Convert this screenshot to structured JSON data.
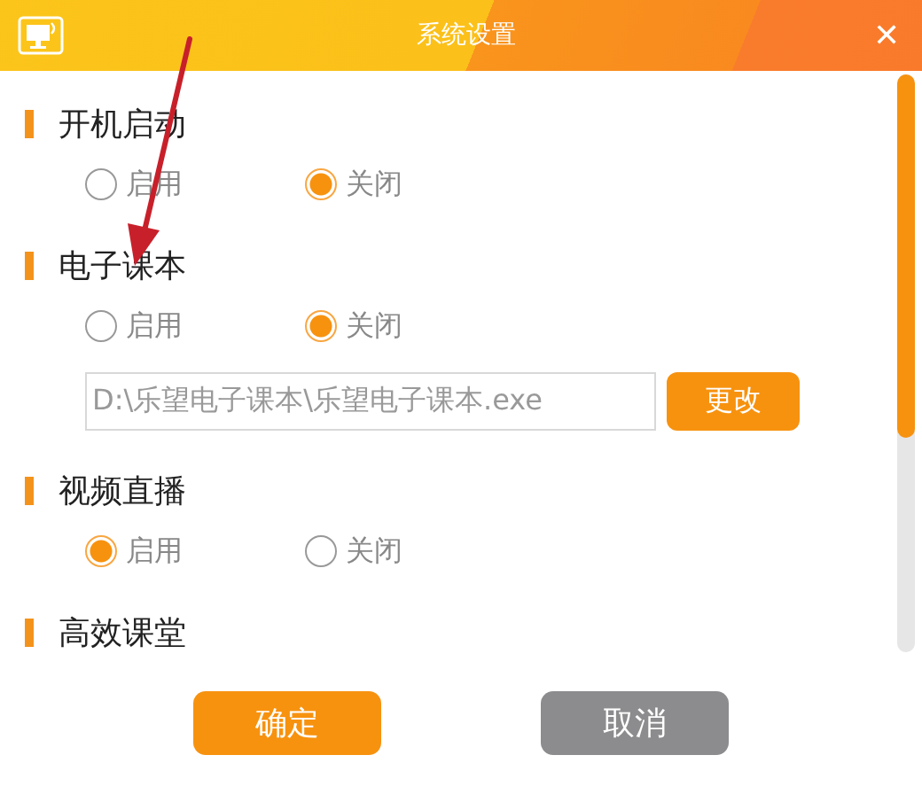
{
  "window": {
    "title": "系统设置",
    "close": "✕"
  },
  "sections": [
    {
      "title": "开机启动",
      "options": [
        {
          "label": "启用",
          "selected": false
        },
        {
          "label": "关闭",
          "selected": true
        }
      ]
    },
    {
      "title": "电子课本",
      "options": [
        {
          "label": "启用",
          "selected": false
        },
        {
          "label": "关闭",
          "selected": true
        }
      ],
      "path": {
        "value": "D:\\乐望电子课本\\乐望电子课本.exe",
        "button": "更改"
      }
    },
    {
      "title": "视频直播",
      "options": [
        {
          "label": "启用",
          "selected": true
        },
        {
          "label": "关闭",
          "selected": false
        }
      ]
    },
    {
      "title": "高效课堂"
    }
  ],
  "buttons": [
    {
      "label": "确定",
      "kind": "primary"
    },
    {
      "label": "取消",
      "kind": "secondary"
    }
  ]
}
